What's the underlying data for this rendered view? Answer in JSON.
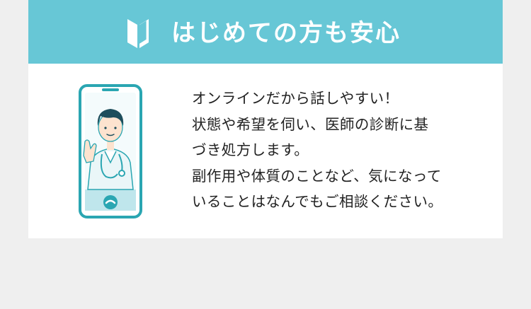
{
  "banner": {
    "icon": "beginner-mark-icon",
    "title": "はじめての方も安心"
  },
  "illustration": {
    "icon": "doctor-on-smartphone-icon"
  },
  "message": {
    "lines": [
      "オンラインだから話しやすい！",
      "状態や希望を伺い、医師の診断に基",
      "づき処方します。",
      "副作用や体質のことなど、気になって",
      "いることはなんでもご相談ください。"
    ]
  },
  "colors": {
    "accent": "#67c7d6",
    "page_background": "#efefef",
    "card_background": "#ffffff",
    "text": "#222222",
    "phone_frame": "#2aa6b2"
  }
}
